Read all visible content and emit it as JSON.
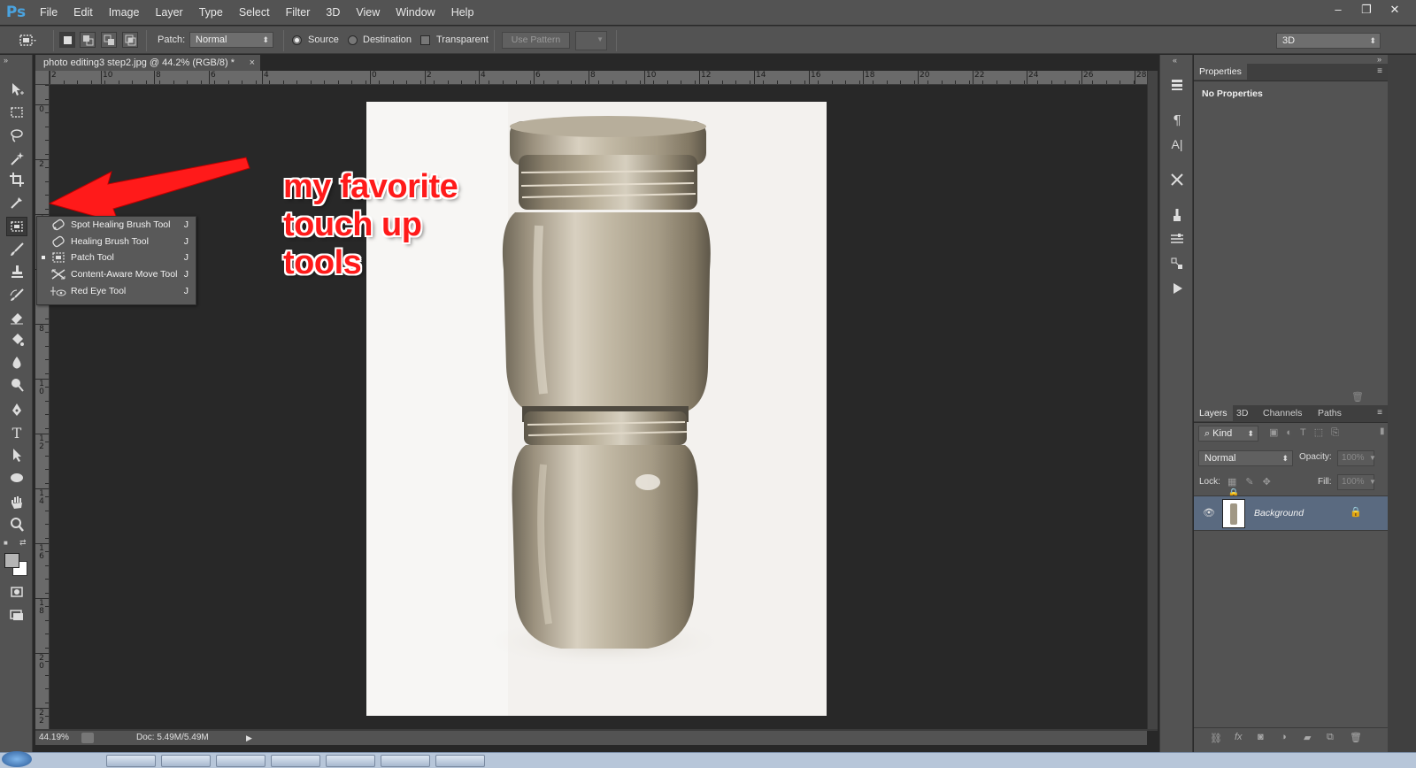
{
  "app": {
    "logo": "Ps",
    "window_controls": {
      "minimize": "–",
      "restore": "❐",
      "close": "✕"
    }
  },
  "menu": [
    "File",
    "Edit",
    "Image",
    "Layer",
    "Type",
    "Select",
    "Filter",
    "3D",
    "View",
    "Window",
    "Help"
  ],
  "options": {
    "patch_label": "Patch:",
    "patch_mode": "Normal",
    "source_label": "Source",
    "destination_label": "Destination",
    "transparent_label": "Transparent",
    "use_pattern_label": "Use Pattern",
    "workspace": "3D",
    "selected_option": "Source"
  },
  "document": {
    "tab_title": "photo editing3 step2.jpg @ 44.2% (RGB/8) *",
    "close": "×",
    "zoom": "44.19%",
    "doc_info": "Doc: 5.49M/5.49M"
  },
  "rulers": {
    "horizontal": [
      "2",
      "10",
      "8",
      "6",
      "4",
      "0",
      "2",
      "4",
      "6",
      "8",
      "10",
      "12",
      "14",
      "16",
      "18",
      "20",
      "22",
      "24",
      "26",
      "28"
    ],
    "vertical": [
      "0",
      "2",
      "4",
      "6",
      "8",
      "10",
      "12",
      "14",
      "16",
      "18",
      "20",
      "22"
    ]
  },
  "flyout": {
    "items": [
      {
        "label": "Spot Healing Brush Tool",
        "key": "J",
        "icon": "spot-healing-brush-icon",
        "selected": false
      },
      {
        "label": "Healing Brush Tool",
        "key": "J",
        "icon": "healing-brush-icon",
        "selected": false
      },
      {
        "label": "Patch Tool",
        "key": "J",
        "icon": "patch-icon",
        "selected": true
      },
      {
        "label": "Content-Aware Move Tool",
        "key": "J",
        "icon": "content-aware-move-icon",
        "selected": false
      },
      {
        "label": "Red Eye Tool",
        "key": "J",
        "icon": "red-eye-icon",
        "selected": false
      }
    ]
  },
  "annotation": {
    "line1": "my favorite",
    "line2": "touch up",
    "line3": "tools",
    "color": "#ff1a1a"
  },
  "properties": {
    "tab": "Properties",
    "message": "No Properties"
  },
  "layers_panel": {
    "tabs": [
      "Layers",
      "3D",
      "Channels",
      "Paths"
    ],
    "kind": "Kind",
    "blend_mode": "Normal",
    "opacity_label": "Opacity:",
    "opacity_value": "100%",
    "lock_label": "Lock:",
    "fill_label": "Fill:",
    "fill_value": "100%",
    "layers": [
      {
        "name": "Background",
        "visible": true,
        "locked": true
      }
    ]
  },
  "colors": {
    "accent": "#4aa3df",
    "panel": "#535353",
    "canvas": "#282828",
    "layer_selected": "#5a6a80"
  }
}
